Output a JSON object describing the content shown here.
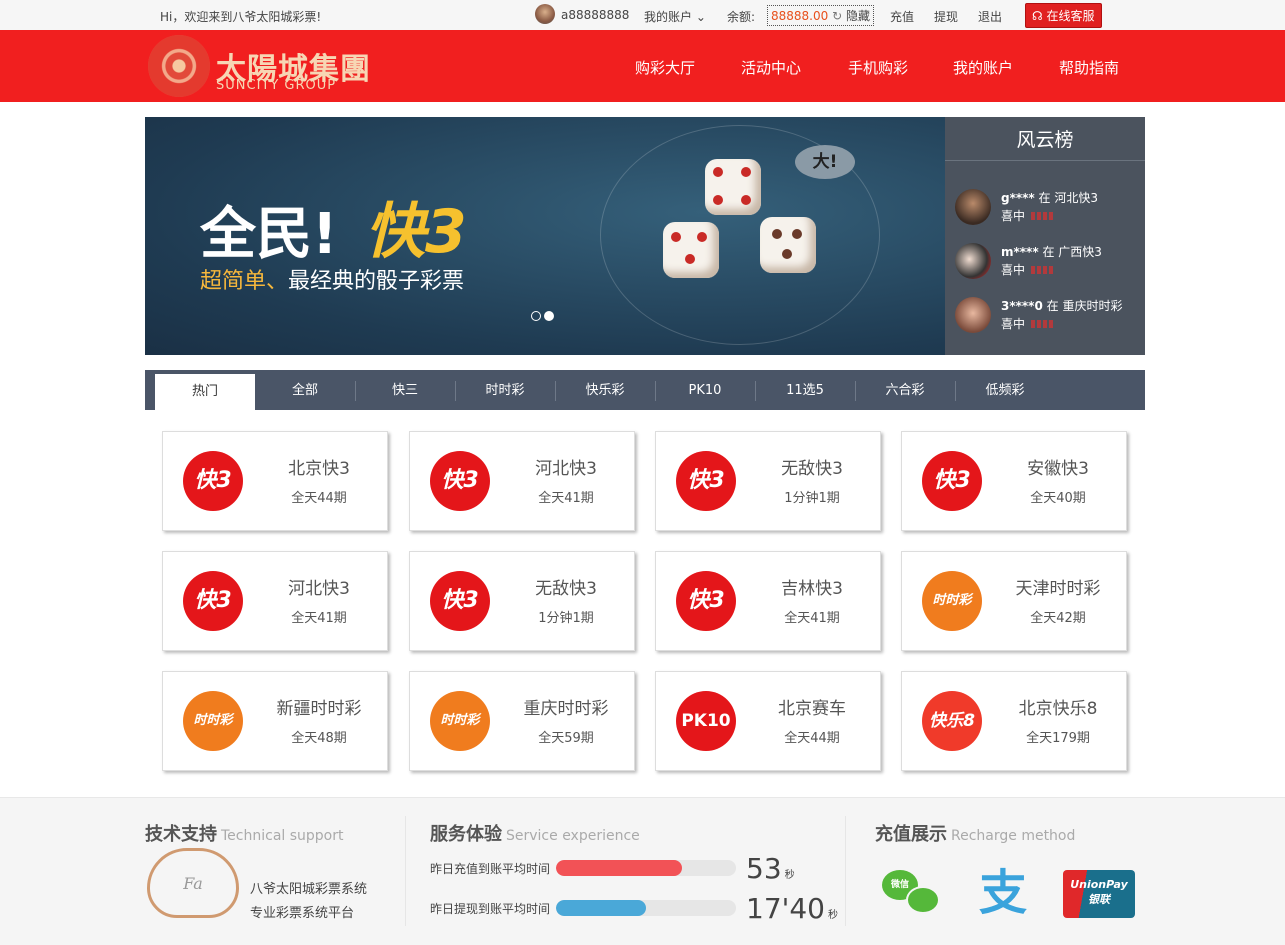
{
  "topbar": {
    "welcome": "Hi，欢迎来到八爷太阳城彩票!",
    "username": "a88888888",
    "account_menu": "我的账户",
    "balance_label": "余额:",
    "balance": "88888.00",
    "refresh_icon": "refresh-icon",
    "hide": "隐藏",
    "recharge": "充值",
    "withdraw": "提现",
    "logout": "退出",
    "service": "在线客服"
  },
  "header": {
    "logo_cn": "太陽城集團",
    "logo_en": "SUNCITY GROUP",
    "nav": [
      "购彩大厅",
      "活动中心",
      "手机购彩",
      "我的账户",
      "帮助指南"
    ],
    "brand_color": "#f11f1f"
  },
  "banner": {
    "title": "全民!",
    "title_hl": "快3",
    "subtitle_hl": "超简单、",
    "subtitle": "最经典的骰子彩票",
    "bubble": "大!",
    "slides": 2,
    "active_slide": 2
  },
  "leaderboard": {
    "title": "风云榜",
    "winners": [
      {
        "user": "g****",
        "in": "在",
        "game": "河北快3",
        "hit": "喜中"
      },
      {
        "user": "m****",
        "in": "在",
        "game": "广西快3",
        "hit": "喜中"
      },
      {
        "user": "3****0",
        "in": "在",
        "game": "重庆时时彩",
        "hit": "喜中"
      }
    ]
  },
  "tabs": [
    "热门",
    "全部",
    "快三",
    "时时彩",
    "快乐彩",
    "PK10",
    "11选5",
    "六合彩",
    "低频彩"
  ],
  "games": [
    {
      "name": "北京快3",
      "period": "全天44期",
      "icon": "快3",
      "type": "k3"
    },
    {
      "name": "河北快3",
      "period": "全天41期",
      "icon": "快3",
      "type": "k3"
    },
    {
      "name": "无敌快3",
      "period": "1分钟1期",
      "icon": "快3",
      "type": "k3"
    },
    {
      "name": "安徽快3",
      "period": "全天40期",
      "icon": "快3",
      "type": "k3"
    },
    {
      "name": "河北快3",
      "period": "全天41期",
      "icon": "快3",
      "type": "k3"
    },
    {
      "name": "无敌快3",
      "period": "1分钟1期",
      "icon": "快3",
      "type": "k3"
    },
    {
      "name": "吉林快3",
      "period": "全天41期",
      "icon": "快3",
      "type": "k3"
    },
    {
      "name": "天津时时彩",
      "period": "全天42期",
      "icon": "时时彩",
      "type": "ssc"
    },
    {
      "name": "新疆时时彩",
      "period": "全天48期",
      "icon": "时时彩",
      "type": "ssc"
    },
    {
      "name": "重庆时时彩",
      "period": "全天59期",
      "icon": "时时彩",
      "type": "ssc"
    },
    {
      "name": "北京赛车",
      "period": "全天44期",
      "icon": "PK10",
      "type": "pk"
    },
    {
      "name": "北京快乐8",
      "period": "全天179期",
      "icon": "快乐8",
      "type": "kl8"
    }
  ],
  "footer": {
    "support": {
      "title": "技术支持",
      "title_en": "Technical support",
      "logo": "Fa",
      "line1": "八爷太阳城彩票系统",
      "line2": "专业彩票系统平台"
    },
    "service": {
      "title": "服务体验",
      "title_en": "Service experience",
      "items": [
        {
          "label": "昨日充值到账平均时间",
          "value": "53",
          "unit": "秒",
          "progress": 0.7,
          "color": "#f25256"
        },
        {
          "label": "昨日提现到账平均时间",
          "value": "17'40",
          "unit": "秒",
          "progress": 0.5,
          "color": "#4aa8d8"
        }
      ]
    },
    "recharge": {
      "title": "充值展示",
      "title_en": "Recharge method",
      "methods": [
        "微信",
        "支",
        "UnionPay 银联"
      ]
    }
  }
}
